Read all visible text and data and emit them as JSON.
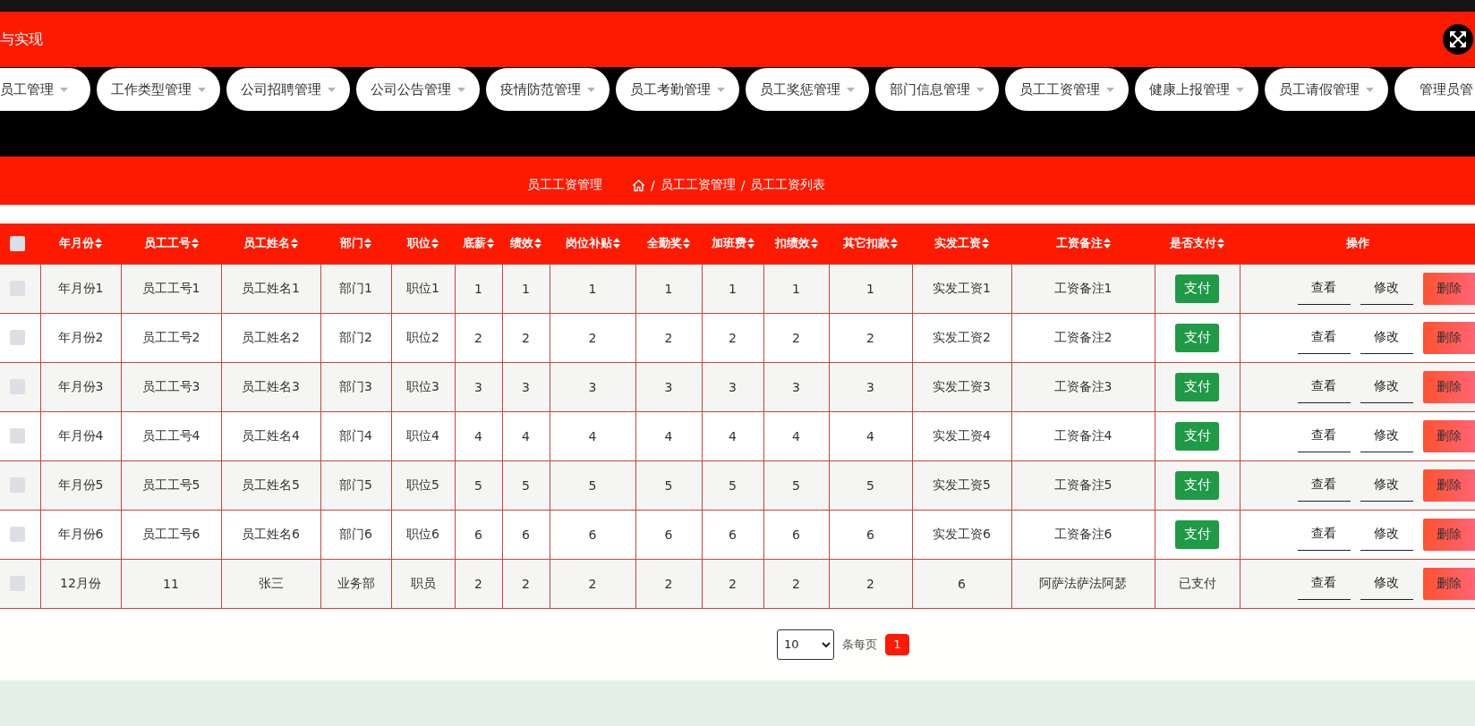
{
  "header": {
    "title": "与实现"
  },
  "nav": {
    "items": [
      {
        "label": "员工管理"
      },
      {
        "label": "工作类型管理"
      },
      {
        "label": "公司招聘管理"
      },
      {
        "label": "公司公告管理"
      },
      {
        "label": "疫情防范管理"
      },
      {
        "label": "员工考勤管理"
      },
      {
        "label": "员工奖惩管理"
      },
      {
        "label": "部门信息管理"
      },
      {
        "label": "员工工资管理"
      },
      {
        "label": "健康上报管理"
      },
      {
        "label": "员工请假管理"
      },
      {
        "label": "管理员管"
      }
    ]
  },
  "breadcrumb": {
    "page_title": "员工工资管理",
    "separator": "/",
    "items": [
      "员工工资管理",
      "员工工资列表"
    ]
  },
  "table": {
    "select_all": {
      "checked": false
    },
    "columns": [
      {
        "label": "年月份",
        "sortable": true
      },
      {
        "label": "员工工号",
        "sortable": true
      },
      {
        "label": "员工姓名",
        "sortable": true
      },
      {
        "label": "部门",
        "sortable": true
      },
      {
        "label": "职位",
        "sortable": true
      },
      {
        "label": "底薪",
        "sortable": true
      },
      {
        "label": "绩效",
        "sortable": true
      },
      {
        "label": "岗位补贴",
        "sortable": true
      },
      {
        "label": "全勤奖",
        "sortable": true
      },
      {
        "label": "加班费",
        "sortable": true
      },
      {
        "label": "扣绩效",
        "sortable": true
      },
      {
        "label": "其它扣款",
        "sortable": true
      },
      {
        "label": "实发工资",
        "sortable": true
      },
      {
        "label": "工资备注",
        "sortable": true
      },
      {
        "label": "是否支付",
        "sortable": true
      },
      {
        "label": "操作",
        "sortable": false
      }
    ],
    "rows": [
      {
        "checked": false,
        "cells": [
          "年月份1",
          "员工工号1",
          "员工姓名1",
          "部门1",
          "职位1",
          "1",
          "1",
          "1",
          "1",
          "1",
          "1",
          "1",
          "实发工资1",
          "工资备注1"
        ],
        "payment": {
          "kind": "button",
          "label": "支付"
        },
        "actions": [
          {
            "kind": "view",
            "label": "查看"
          },
          {
            "kind": "edit",
            "label": "修改"
          },
          {
            "kind": "delete",
            "label": "删除"
          }
        ]
      },
      {
        "checked": false,
        "cells": [
          "年月份2",
          "员工工号2",
          "员工姓名2",
          "部门2",
          "职位2",
          "2",
          "2",
          "2",
          "2",
          "2",
          "2",
          "2",
          "实发工资2",
          "工资备注2"
        ],
        "payment": {
          "kind": "button",
          "label": "支付"
        },
        "actions": [
          {
            "kind": "view",
            "label": "查看"
          },
          {
            "kind": "edit",
            "label": "修改"
          },
          {
            "kind": "delete",
            "label": "删除"
          }
        ]
      },
      {
        "checked": false,
        "cells": [
          "年月份3",
          "员工工号3",
          "员工姓名3",
          "部门3",
          "职位3",
          "3",
          "3",
          "3",
          "3",
          "3",
          "3",
          "3",
          "实发工资3",
          "工资备注3"
        ],
        "payment": {
          "kind": "button",
          "label": "支付"
        },
        "actions": [
          {
            "kind": "view",
            "label": "查看"
          },
          {
            "kind": "edit",
            "label": "修改"
          },
          {
            "kind": "delete",
            "label": "删除"
          }
        ]
      },
      {
        "checked": false,
        "cells": [
          "年月份4",
          "员工工号4",
          "员工姓名4",
          "部门4",
          "职位4",
          "4",
          "4",
          "4",
          "4",
          "4",
          "4",
          "4",
          "实发工资4",
          "工资备注4"
        ],
        "payment": {
          "kind": "button",
          "label": "支付"
        },
        "actions": [
          {
            "kind": "view",
            "label": "查看"
          },
          {
            "kind": "edit",
            "label": "修改"
          },
          {
            "kind": "delete",
            "label": "删除"
          }
        ]
      },
      {
        "checked": false,
        "cells": [
          "年月份5",
          "员工工号5",
          "员工姓名5",
          "部门5",
          "职位5",
          "5",
          "5",
          "5",
          "5",
          "5",
          "5",
          "5",
          "实发工资5",
          "工资备注5"
        ],
        "payment": {
          "kind": "button",
          "label": "支付"
        },
        "actions": [
          {
            "kind": "view",
            "label": "查看"
          },
          {
            "kind": "edit",
            "label": "修改"
          },
          {
            "kind": "delete",
            "label": "删除"
          }
        ]
      },
      {
        "checked": false,
        "cells": [
          "年月份6",
          "员工工号6",
          "员工姓名6",
          "部门6",
          "职位6",
          "6",
          "6",
          "6",
          "6",
          "6",
          "6",
          "6",
          "实发工资6",
          "工资备注6"
        ],
        "payment": {
          "kind": "button",
          "label": "支付"
        },
        "actions": [
          {
            "kind": "view",
            "label": "查看"
          },
          {
            "kind": "edit",
            "label": "修改"
          },
          {
            "kind": "delete",
            "label": "删除"
          }
        ]
      },
      {
        "checked": false,
        "cells": [
          "12月份",
          "11",
          "张三",
          "业务部",
          "职员",
          "2",
          "2",
          "2",
          "2",
          "2",
          "2",
          "2",
          "6",
          "阿萨法萨法阿瑟"
        ],
        "payment": {
          "kind": "text",
          "label": "已支付"
        },
        "actions": [
          {
            "kind": "view",
            "label": "查看"
          },
          {
            "kind": "edit",
            "label": "修改"
          },
          {
            "kind": "delete",
            "label": "删除"
          }
        ]
      }
    ]
  },
  "pagination": {
    "page_size": "10",
    "per_page_label": "条每页",
    "pages": [
      {
        "label": "1",
        "selected": true
      }
    ]
  }
}
